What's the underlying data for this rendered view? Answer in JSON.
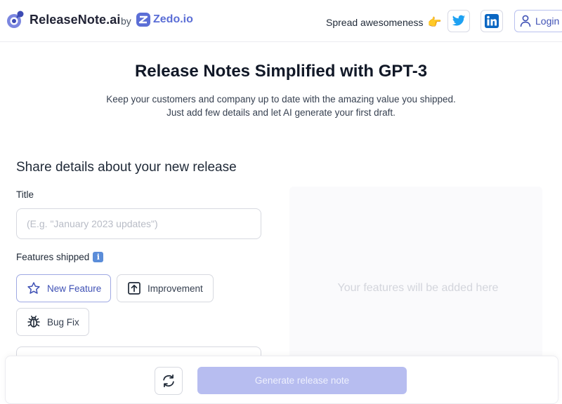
{
  "header": {
    "brand_name": "ReleaseNote.ai",
    "by_label": "by",
    "partner_name": "Zedo.io",
    "spread_text": "Spread awesomeness",
    "spread_emoji": "👉",
    "login_label": "Login",
    "social": [
      "twitter-icon",
      "linkedin-icon"
    ]
  },
  "hero": {
    "title": "Release Notes Simplified with GPT-3",
    "subtitle_line1": "Keep your customers and company up to date with the amazing value you shipped.",
    "subtitle_line2": "Just add few details and let AI generate your first draft."
  },
  "form": {
    "section_title": "Share details about your new release",
    "title_label": "Title",
    "title_placeholder": "(E.g. \"January 2023 updates\")",
    "title_value": "",
    "features_label": "Features shipped",
    "feature_types": [
      {
        "label": "New Feature",
        "icon": "star-icon",
        "active": true
      },
      {
        "label": "Improvement",
        "icon": "arrow-up-box-icon",
        "active": false
      },
      {
        "label": "Bug Fix",
        "icon": "bug-icon",
        "active": false
      }
    ]
  },
  "preview": {
    "empty_text": "Your features will be added here"
  },
  "footer": {
    "reset_icon": "refresh-icon",
    "generate_label": "Generate release note"
  },
  "colors": {
    "accent": "#3f51b5",
    "brand_text": "#222436",
    "partner": "#5b6ed6",
    "generate_disabled": "#b7bdf0",
    "twitter": "#1da1f2",
    "linkedin": "#0a66c2"
  }
}
